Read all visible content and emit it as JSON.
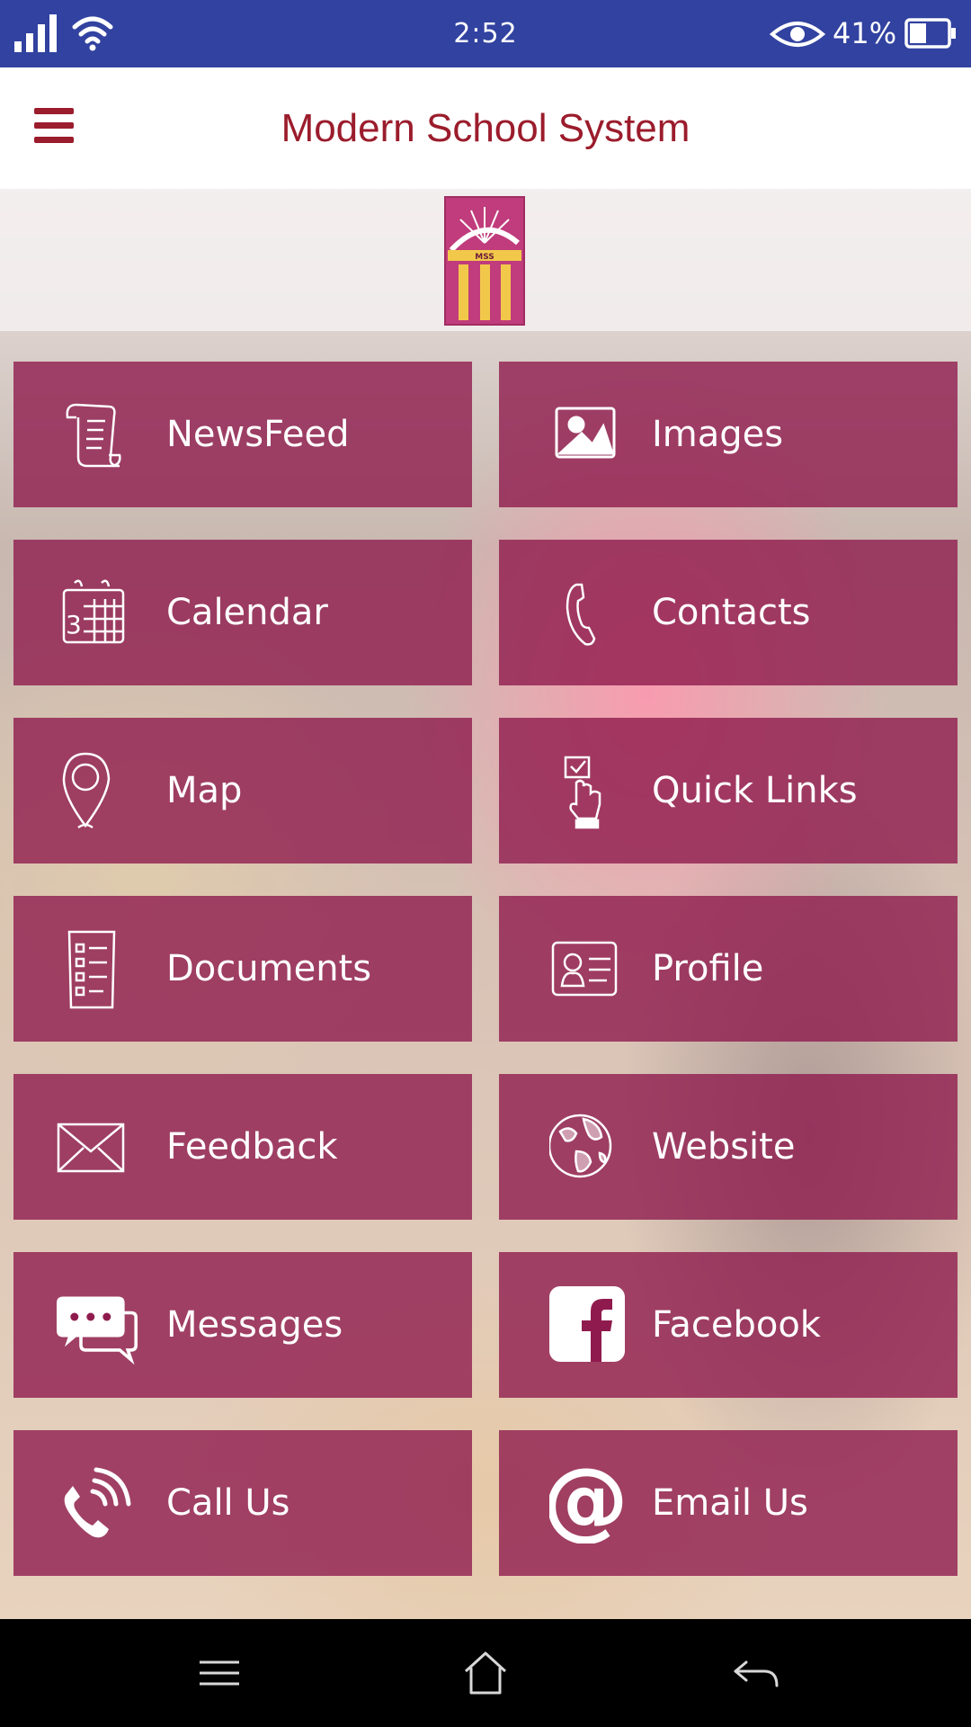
{
  "status_bar": {
    "time": "2:52",
    "battery": "41%",
    "background": "#3142a0",
    "icons": [
      "signal-icon",
      "wifi-icon",
      "eye-icon",
      "battery-icon"
    ]
  },
  "header": {
    "title": "Modern School System",
    "accent": "#9b1c2c"
  },
  "logo": {
    "text": "MSS"
  },
  "tiles": [
    {
      "label": "NewsFeed",
      "icon": "scroll-icon"
    },
    {
      "label": "Images",
      "icon": "image-icon"
    },
    {
      "label": "Calendar",
      "icon": "calendar-icon"
    },
    {
      "label": "Contacts",
      "icon": "phone-handset-icon"
    },
    {
      "label": "Map",
      "icon": "map-pin-icon"
    },
    {
      "label": "Quick Links",
      "icon": "pointer-hand-icon"
    },
    {
      "label": "Documents",
      "icon": "checklist-icon"
    },
    {
      "label": "Profile",
      "icon": "id-card-icon"
    },
    {
      "label": "Feedback",
      "icon": "envelope-icon"
    },
    {
      "label": "Website",
      "icon": "globe-icon"
    },
    {
      "label": "Messages",
      "icon": "chat-bubbles-icon"
    },
    {
      "label": "Facebook",
      "icon": "facebook-icon"
    },
    {
      "label": "Call Us",
      "icon": "phone-ringing-icon"
    },
    {
      "label": "Email Us",
      "icon": "at-sign-icon"
    }
  ],
  "tile_color": "#8f1b4e",
  "nav_bar": {
    "buttons": [
      "menu-icon",
      "home-icon",
      "back-icon"
    ]
  }
}
